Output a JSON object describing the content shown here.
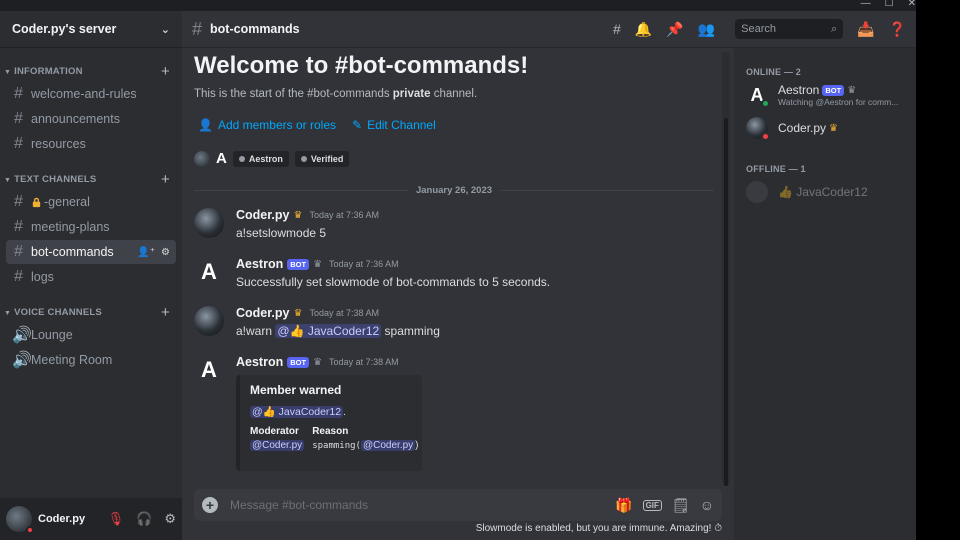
{
  "server": {
    "name": "Coder.py's server"
  },
  "categories": {
    "information": "INFORMATION",
    "text": "TEXT CHANNELS",
    "voice": "VOICE CHANNELS"
  },
  "channels": {
    "information": [
      "welcome-and-rules",
      "announcements",
      "resources"
    ],
    "text": [
      "-general",
      "meeting-plans",
      "bot-commands",
      "logs"
    ],
    "voice": [
      "Lounge",
      "Meeting Room"
    ]
  },
  "user_panel": {
    "username": "Coder.py"
  },
  "topbar": {
    "channel": "bot-commands",
    "search_placeholder": "Search"
  },
  "welcome": {
    "title": "Welcome to #bot-commands!",
    "sub_prefix": "This is the start of the #bot-commands ",
    "sub_bold": "private",
    "sub_suffix": " channel.",
    "add_members": "Add members or roles",
    "edit_channel": "Edit Channel",
    "tag_aestron": "Aestron",
    "tag_verified": "Verified"
  },
  "date_divider": "January 26, 2023",
  "messages": [
    {
      "author": "Coder.py",
      "time": "Today at 7:36 AM",
      "text": "a!setslowmode 5"
    },
    {
      "author": "Aestron",
      "badge": "BOT",
      "time": "Today at 7:36 AM",
      "text": "Successfully set slowmode of bot-commands to 5 seconds."
    },
    {
      "author": "Coder.py",
      "time": "Today at 7:38 AM",
      "text_prefix": "a!warn ",
      "mention": "@👍 JavaCoder12",
      "text_suffix": " spamming"
    },
    {
      "author": "Aestron",
      "badge": "BOT",
      "time": "Today at 7:38 AM"
    }
  ],
  "embed": {
    "title": "Member warned",
    "mention": "@👍 JavaCoder12",
    "desc_suffix": ".",
    "field1_name": "Moderator",
    "field1_value": "@Coder.py",
    "field2_name": "Reason",
    "field2_value_prefix": "spamming(",
    "field2_mention": "@Coder.py",
    "field2_value_suffix": ")"
  },
  "composer": {
    "placeholder": "Message #bot-commands"
  },
  "slowmode_notice": "Slowmode is enabled, but you are immune. Amazing!",
  "member_list": {
    "online_header": "ONLINE — 2",
    "offline_header": "OFFLINE — 1",
    "online": [
      {
        "name": "Aestron",
        "badge": "BOT",
        "status": "Watching @Aestron for comm..."
      },
      {
        "name": "Coder.py"
      }
    ],
    "offline": [
      {
        "name": "👍 JavaCoder12"
      }
    ]
  },
  "colors": {
    "accent": "#5865f2",
    "link": "#00a8fc",
    "online": "#23a55a",
    "dnd": "#f23f43",
    "crown": "#f0b232"
  }
}
